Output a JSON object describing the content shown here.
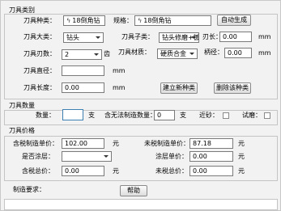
{
  "category": {
    "title": "刀具类别",
    "type_label": "刀具种类：",
    "type_value": "18倒角钻",
    "spec_label": "规格：",
    "spec_value": "18倒角钻",
    "auto_generate": "自动生成",
    "major_label": "刀具大类：",
    "major_value": "钻头",
    "minor_label": "刀具子类：",
    "minor_value": "钻头修磨+镀",
    "edge_length_label": "刃长：",
    "edge_length_value": "0.00",
    "edge_unit": "mm",
    "blade_count_label": "刀具刃数：",
    "blade_count_value": "2",
    "blade_unit": "齿",
    "material_label": "刀具材质：",
    "material_value": "硬质合金",
    "handle_label": "柄径：",
    "handle_value": "0.00",
    "handle_unit": "mm",
    "diameter_label": "刀具直径：",
    "diameter_value": "",
    "diameter_unit": "mm",
    "length_label": "刀具长度：",
    "length_value": "0.00",
    "length_unit": "mm",
    "new_type_button": "建立新种类",
    "delete_type_button": "删除该种类"
  },
  "quantity": {
    "title": "刀具数量",
    "qty_label": "数量：",
    "qty_value": "",
    "qty_unit": "支",
    "unmade_label": "含无法制造数量：",
    "unmade_value": "0",
    "unmade_unit": "支",
    "urgent_label": "近砂：",
    "trial_label": "试磨："
  },
  "price": {
    "title": "刀具价格",
    "taxed_unit_label": "含税制造单价：",
    "taxed_unit_value": "102.00",
    "taxed_unit_currency": "元",
    "untaxed_unit_label": "未税制造单价：",
    "untaxed_unit_value": "87.18",
    "untaxed_unit_currency": "元",
    "coating_label": "是否涂层：",
    "coating_value": "",
    "coating_unit_label": "涂层单价：",
    "coating_unit_value": "0.00",
    "coating_unit_currency": "元",
    "taxed_total_label": "含税总价：",
    "taxed_total_value": "0.00",
    "taxed_total_currency": "元",
    "untaxed_total_label": "未税总价：",
    "untaxed_total_value": "0.00",
    "untaxed_total_currency": "元"
  },
  "requirement": {
    "label": "制造要求：",
    "help_button": "帮助"
  }
}
